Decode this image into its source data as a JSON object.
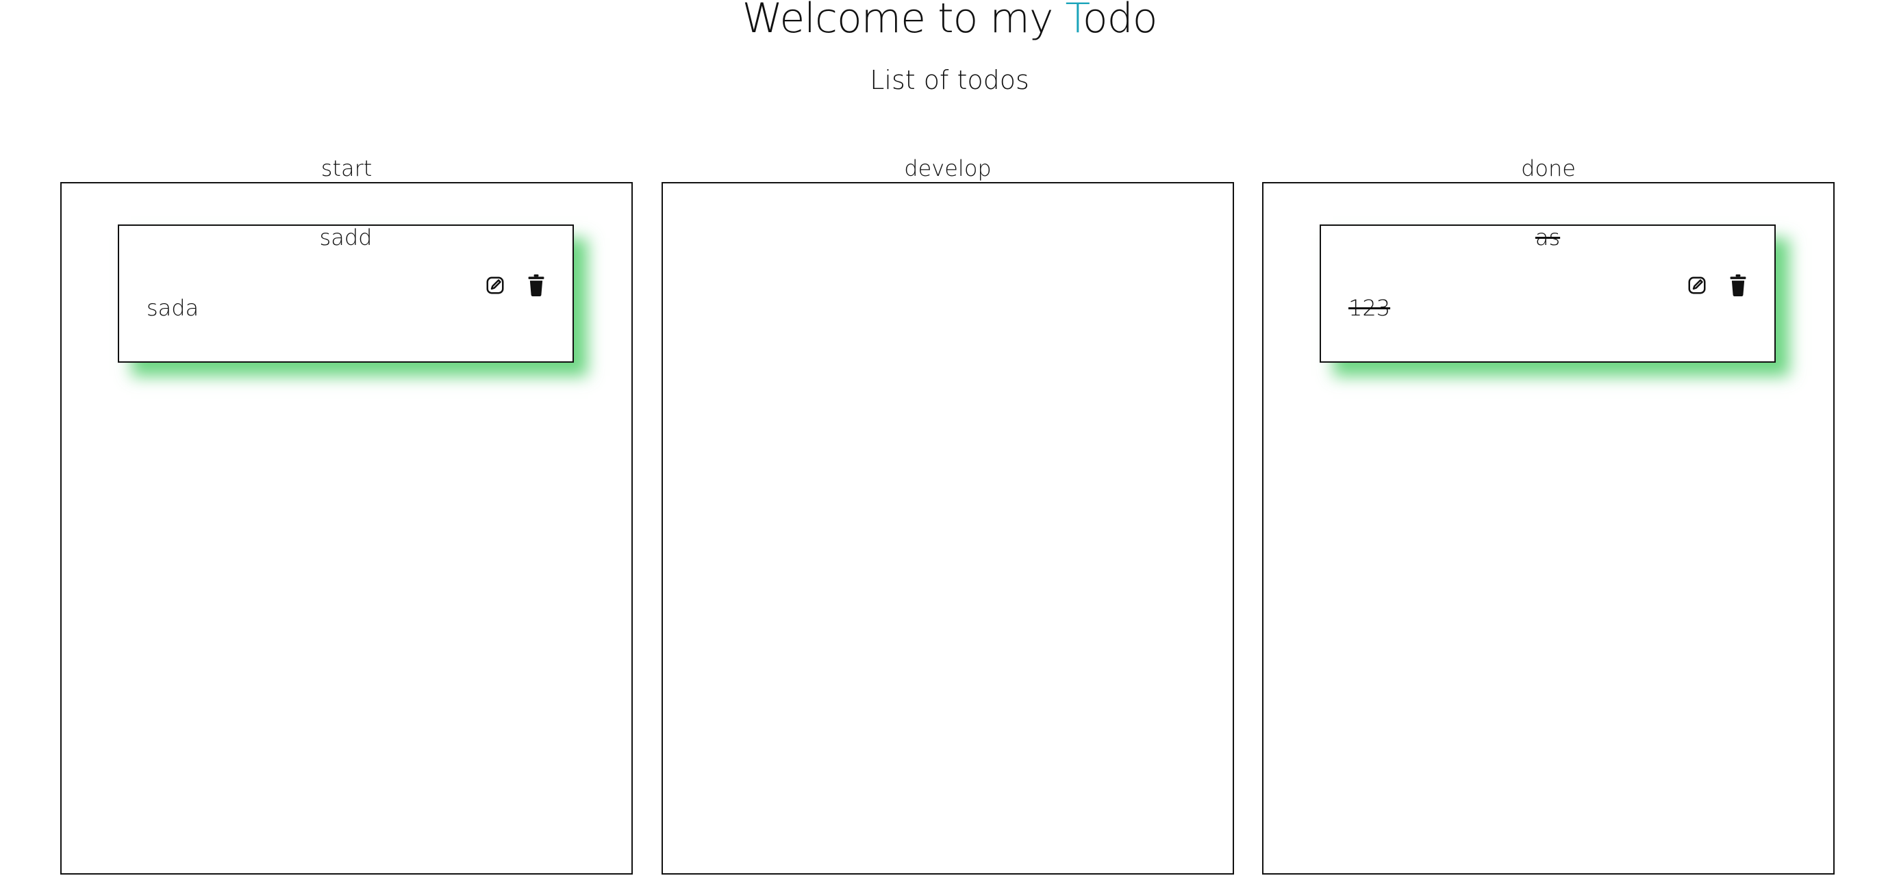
{
  "header": {
    "title_prefix": "Welcome to my ",
    "title_accent": "T",
    "title_suffix": "odo",
    "subtitle": "List of todos"
  },
  "columns": [
    {
      "label": "start",
      "cards": [
        {
          "title": "sadd",
          "description": "sada"
        }
      ]
    },
    {
      "label": "develop",
      "cards": []
    },
    {
      "label": "done",
      "cards": [
        {
          "title": "as",
          "description": "123"
        }
      ]
    }
  ],
  "icons": {
    "edit": "edit-icon",
    "delete": "trash-icon"
  },
  "colors": {
    "accent": "#1ba3ba",
    "card_shadow": "#3cc85a"
  }
}
